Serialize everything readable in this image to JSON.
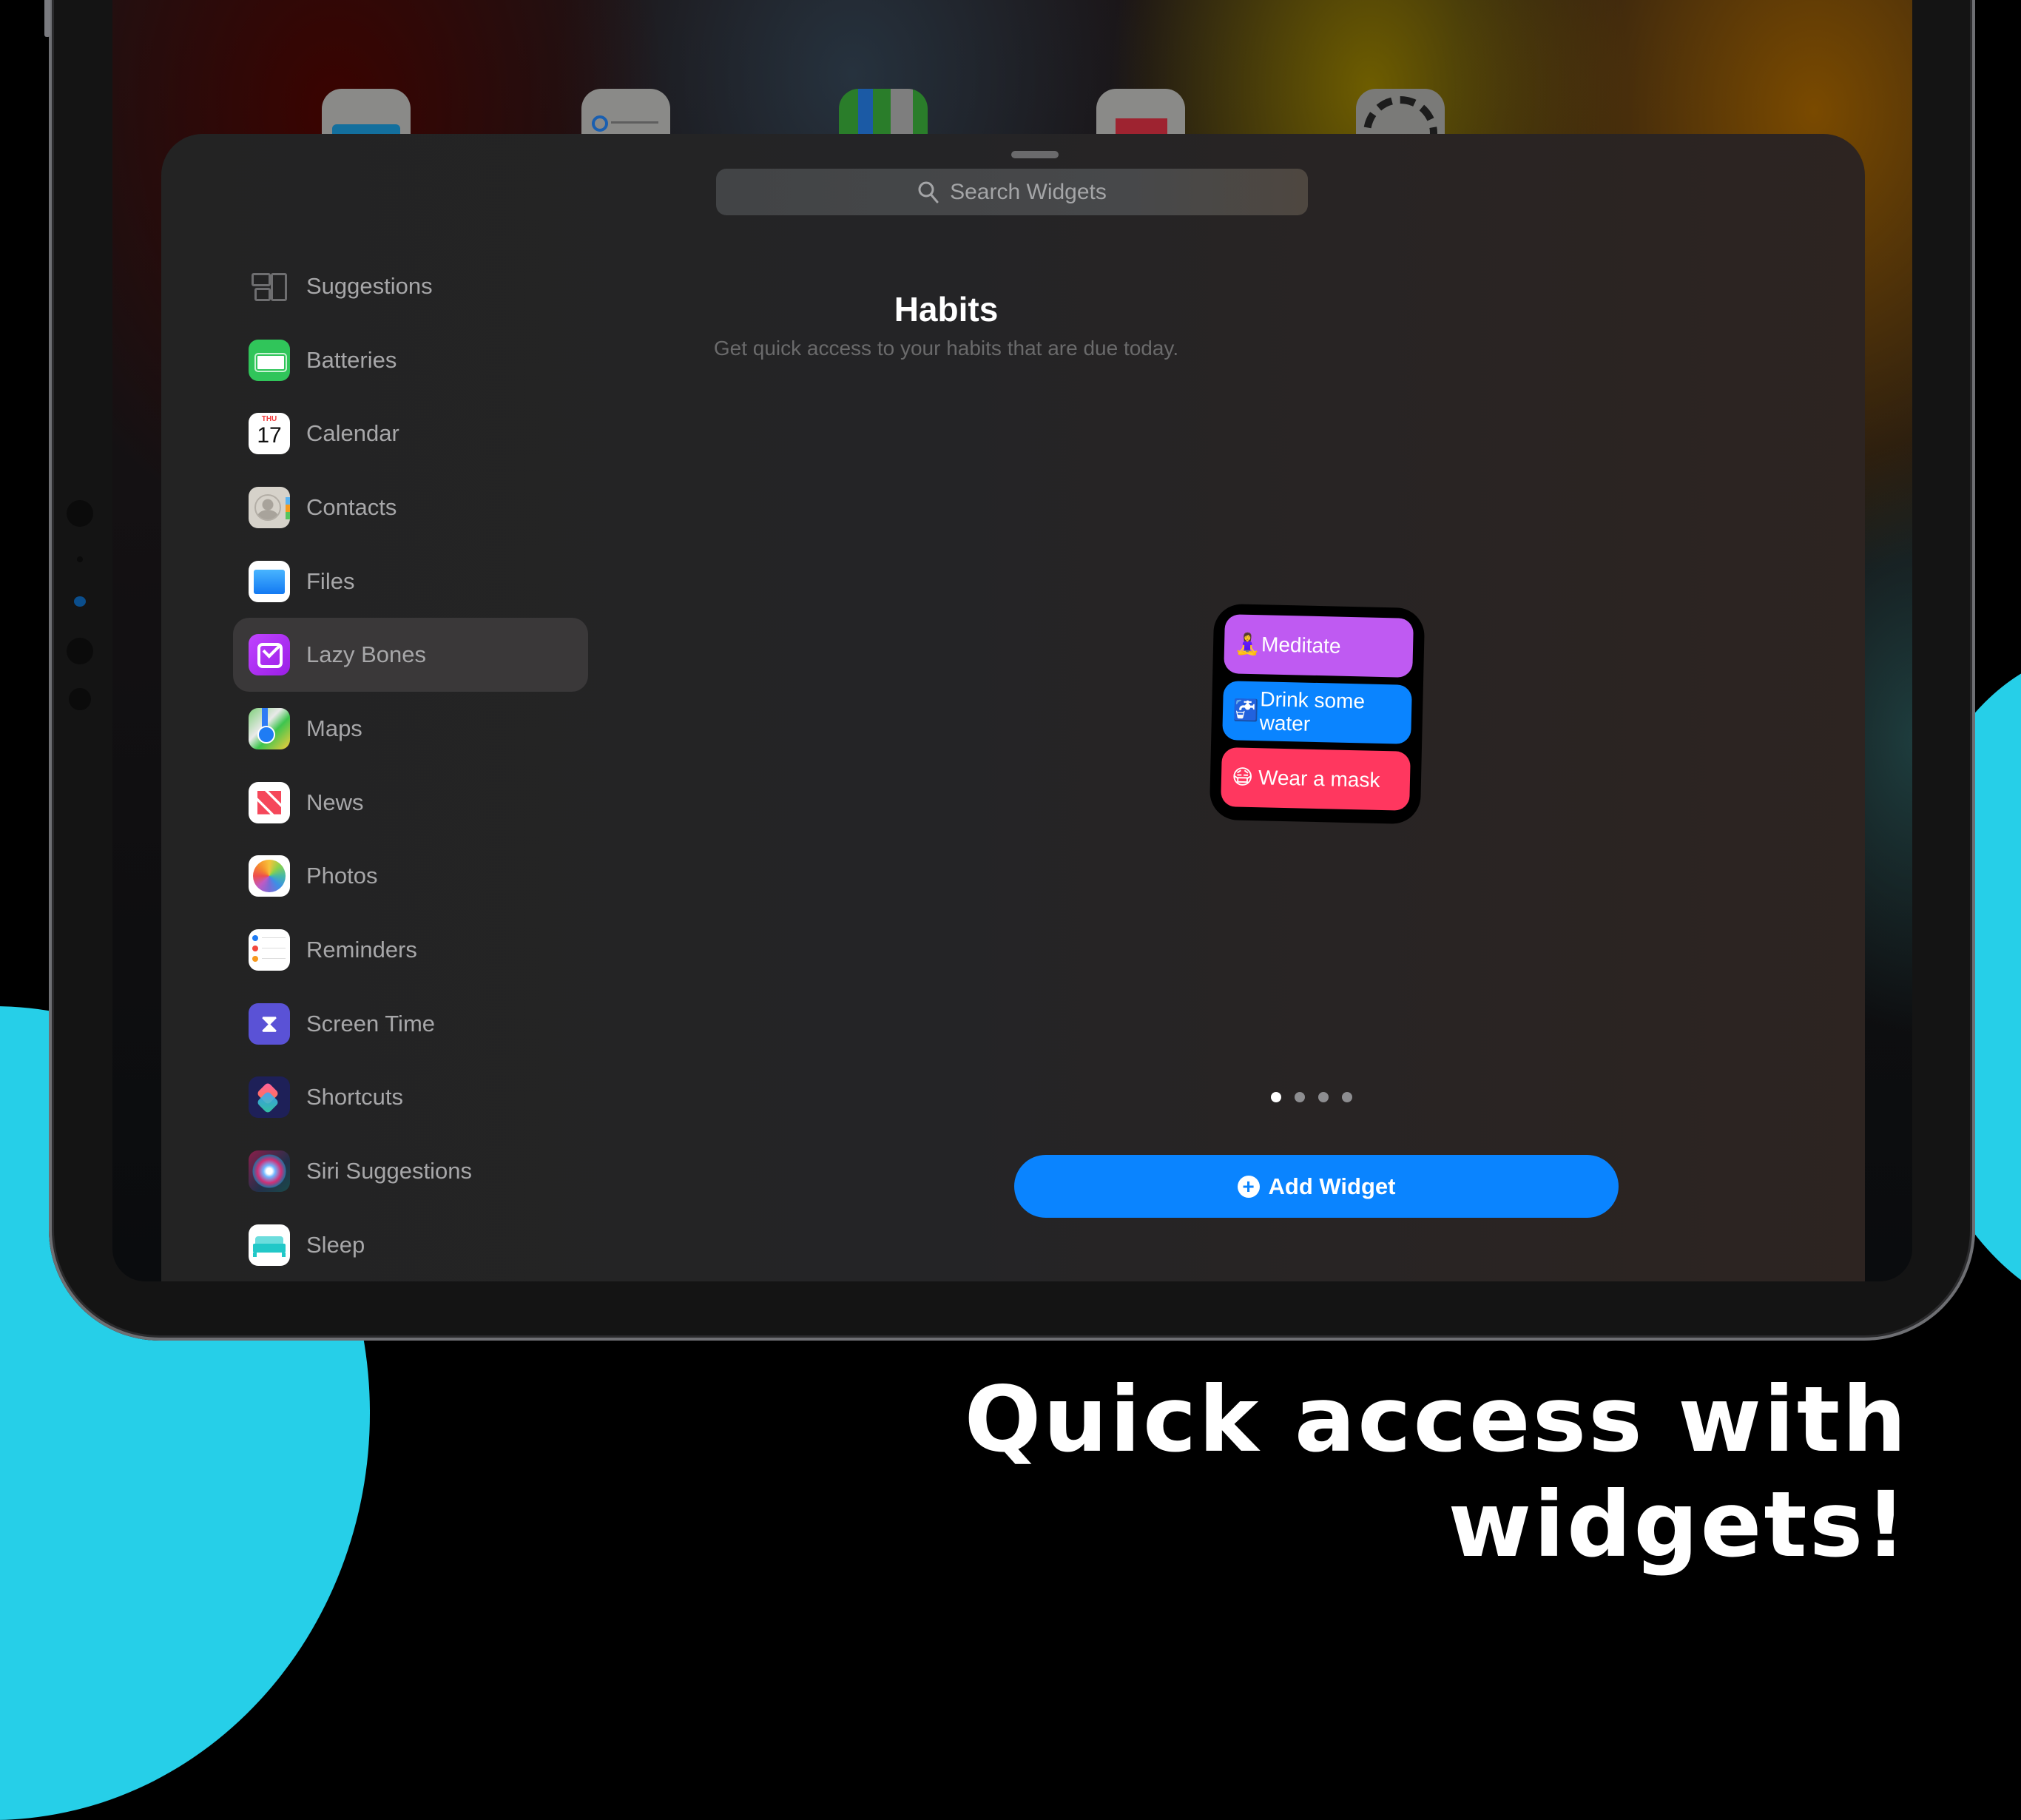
{
  "caption": "Quick access with widgets!",
  "colors": {
    "accent_blue": "#0a84ff",
    "background_cyan": "#26cfe8",
    "habit_purple": "#bf5af2",
    "habit_blue": "#0a84ff",
    "habit_red": "#ff375f"
  },
  "home_screen": {
    "dock_icons": [
      "files-icon",
      "reminders-icon",
      "maps-icon",
      "news-icon",
      "settings-icon"
    ]
  },
  "widget_gallery": {
    "search": {
      "placeholder": "Search Widgets",
      "icon": "search-icon"
    },
    "sidebar": {
      "selected": "Lazy Bones",
      "items": [
        {
          "label": "Suggestions",
          "icon": "suggestions-icon"
        },
        {
          "label": "Batteries",
          "icon": "batteries-icon"
        },
        {
          "label": "Calendar",
          "icon": "calendar-icon",
          "day": "THU",
          "date": "17"
        },
        {
          "label": "Contacts",
          "icon": "contacts-icon"
        },
        {
          "label": "Files",
          "icon": "files-icon"
        },
        {
          "label": "Lazy Bones",
          "icon": "lazy-bones-icon"
        },
        {
          "label": "Maps",
          "icon": "maps-icon"
        },
        {
          "label": "News",
          "icon": "news-icon"
        },
        {
          "label": "Photos",
          "icon": "photos-icon"
        },
        {
          "label": "Reminders",
          "icon": "reminders-icon"
        },
        {
          "label": "Screen Time",
          "icon": "screen-time-icon"
        },
        {
          "label": "Shortcuts",
          "icon": "shortcuts-icon"
        },
        {
          "label": "Siri Suggestions",
          "icon": "siri-icon"
        },
        {
          "label": "Sleep",
          "icon": "sleep-icon"
        }
      ]
    },
    "detail": {
      "title": "Habits",
      "subtitle": "Get quick access to your habits that are due today.",
      "habits": [
        {
          "emoji": "🧘‍♀️",
          "label": "Meditate",
          "color": "#bf5af2"
        },
        {
          "emoji": "🚰",
          "label": "Drink some water",
          "color": "#0a84ff"
        },
        {
          "emoji": "😷",
          "label": "Wear a mask",
          "color": "#ff375f"
        }
      ],
      "page_indicator": {
        "count": 4,
        "current": 1
      },
      "add_button": "Add Widget"
    }
  }
}
